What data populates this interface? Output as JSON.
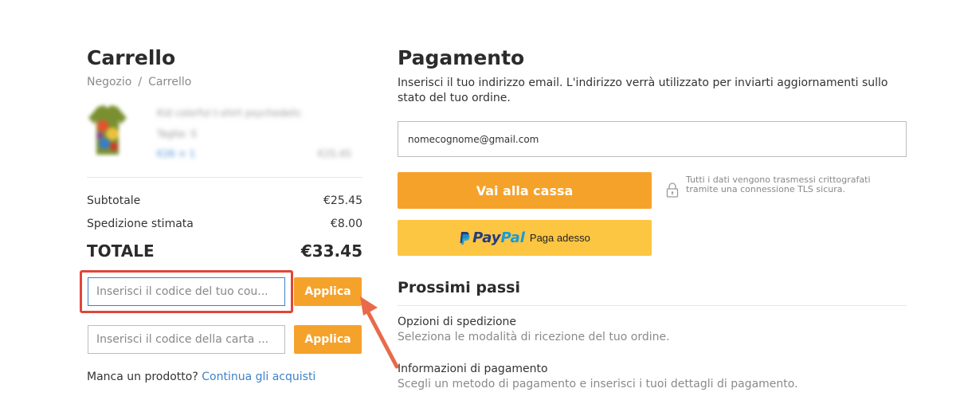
{
  "cart": {
    "title": "Carrello",
    "breadcrumb": [
      "Negozio",
      "Carrello"
    ],
    "product": {
      "name": "Kid colorful t-shirt psychedelic",
      "option": "Taglia: S",
      "qty": "€26 × 1",
      "price": "€25.45"
    },
    "subtotal_label": "Subtotale",
    "subtotal_value": "€25.45",
    "shipping_label": "Spedizione stimata",
    "shipping_value": "€8.00",
    "total_label": "TOTALE",
    "total_value": "€33.45",
    "coupon_placeholder": "Inserisci il codice del tuo cou...",
    "gift_placeholder": "Inserisci il codice della carta ...",
    "apply_label": "Applica",
    "missing_text": "Manca un prodotto?",
    "continue_link": "Continua gli acquisti"
  },
  "payment": {
    "title": "Pagamento",
    "description": "Inserisci il tuo indirizzo email. L'indirizzo verrà utilizzato per inviarti aggiornamenti sullo stato del tuo ordine.",
    "email_value": "nomecognome@gmail.com",
    "checkout_label": "Vai alla cassa",
    "secure_text": "Tutti i dati vengono trasmessi crittografati tramite una connessione TLS sicura.",
    "paypal_pay": "Pay",
    "paypal_pal": "Pal",
    "paypal_sub": "Paga adesso",
    "next_title": "Prossimi passi",
    "steps": [
      {
        "title": "Opzioni di spedizione",
        "desc": "Seleziona le modalità di ricezione del tuo ordine."
      },
      {
        "title": "Informazioni di pagamento",
        "desc": "Scegli un metodo di pagamento e inserisci i tuoi dettagli di pagamento."
      }
    ]
  },
  "colors": {
    "accent_orange": "#f5a22b",
    "highlight_red": "#e0463a",
    "paypal_yellow": "#fcc542",
    "link_blue": "#3d82c9"
  },
  "icons": [
    "lock-icon",
    "paypal-logo",
    "tshirt-thumbnail",
    "annotation-arrow"
  ]
}
